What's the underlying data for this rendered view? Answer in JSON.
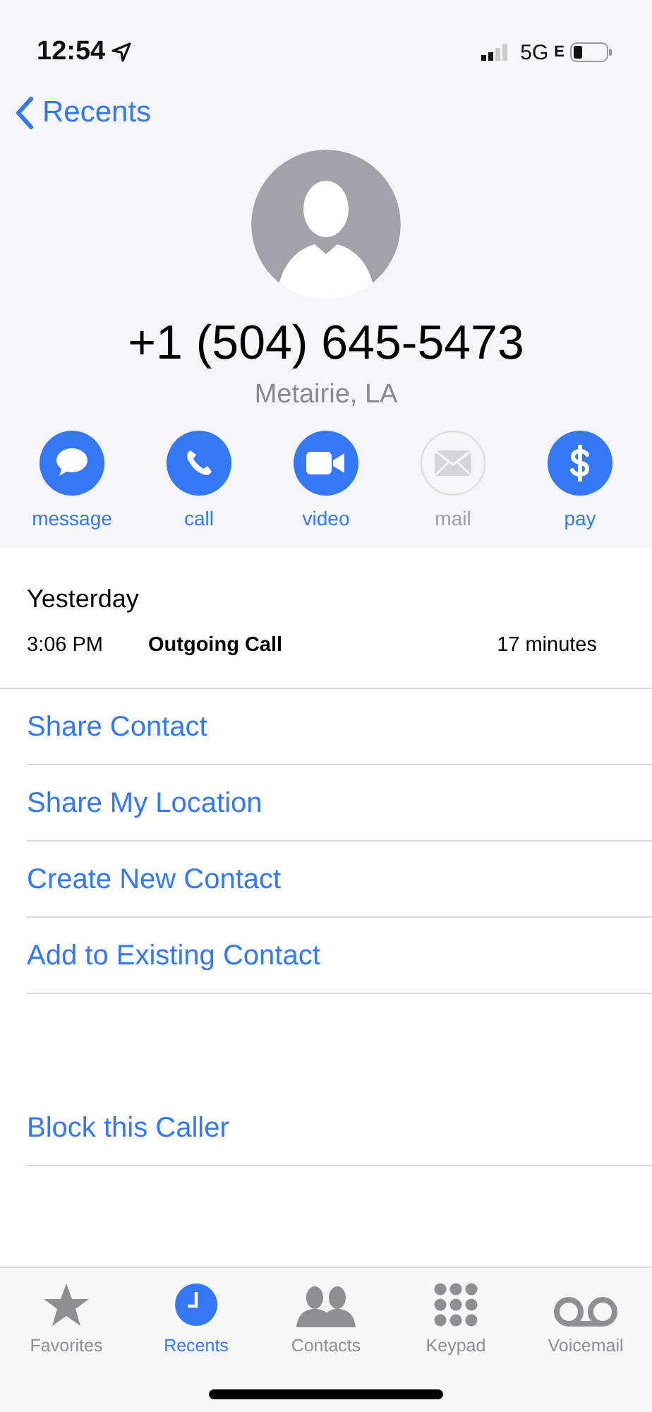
{
  "status_bar": {
    "time": "12:54",
    "network": "5G",
    "network_suffix": "E"
  },
  "nav": {
    "back_label": "Recents"
  },
  "contact": {
    "number": "+1 (504) 645-5473",
    "location": "Metairie, LA"
  },
  "actions": [
    {
      "kind": "message",
      "label": "message",
      "disabled": false
    },
    {
      "kind": "call",
      "label": "call",
      "disabled": false
    },
    {
      "kind": "video",
      "label": "video",
      "disabled": false
    },
    {
      "kind": "mail",
      "label": "mail",
      "disabled": true
    },
    {
      "kind": "pay",
      "label": "pay",
      "disabled": false
    }
  ],
  "history": {
    "date": "Yesterday",
    "entries": [
      {
        "time": "3:06 PM",
        "type": "Outgoing Call",
        "duration": "17 minutes"
      }
    ]
  },
  "options": [
    "Share Contact",
    "Share My Location",
    "Create New Contact",
    "Add to Existing Contact"
  ],
  "block_option": "Block this Caller",
  "tabs": [
    {
      "kind": "favorites",
      "label": "Favorites",
      "selected": false
    },
    {
      "kind": "recents",
      "label": "Recents",
      "selected": true
    },
    {
      "kind": "contacts",
      "label": "Contacts",
      "selected": false
    },
    {
      "kind": "keypad",
      "label": "Keypad",
      "selected": false
    },
    {
      "kind": "voicemail",
      "label": "Voicemail",
      "selected": false
    }
  ]
}
